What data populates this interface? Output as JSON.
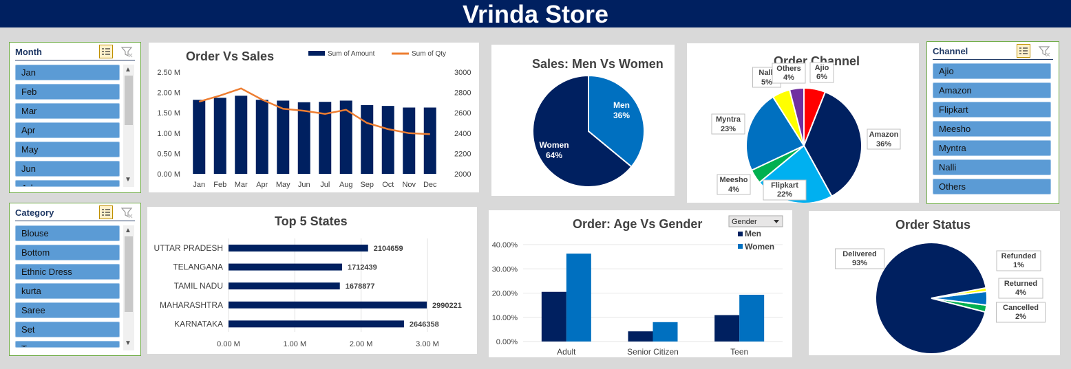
{
  "header": {
    "title": "Vrinda Store"
  },
  "colors": {
    "navy": "#002060",
    "blue": "#0070c0",
    "orange": "#ed7d31",
    "slicer_item": "#5b9bd5"
  },
  "slicers": {
    "month": {
      "title": "Month",
      "items": [
        "Jan",
        "Feb",
        "Mar",
        "Apr",
        "May",
        "Jun",
        "Jul"
      ]
    },
    "category": {
      "title": "Category",
      "items": [
        "Blouse",
        "Bottom",
        "Ethnic Dress",
        "kurta",
        "Saree",
        "Set",
        "Top"
      ]
    },
    "channel": {
      "title": "Channel",
      "items": [
        "Ajio",
        "Amazon",
        "Flipkart",
        "Meesho",
        "Myntra",
        "Nalli",
        "Others"
      ]
    }
  },
  "order_vs_sales": {
    "title": "Order Vs Sales",
    "legend": [
      "Sum of Amount",
      "Sum of Qty"
    ],
    "left_ticks": [
      "2.50 M",
      "2.00 M",
      "1.50 M",
      "1.00 M",
      "0.50 M",
      "0.00 M"
    ],
    "right_ticks": [
      "3000",
      "2800",
      "2600",
      "2400",
      "2200",
      "2000"
    ]
  },
  "sales_men_women": {
    "title": "Sales: Men Vs Women",
    "men": "Men",
    "men_pct": "36%",
    "women": "Women",
    "women_pct": "64%"
  },
  "order_channel": {
    "title": "Order Channel"
  },
  "top_states": {
    "title": "Top 5 States",
    "xticks": [
      "0.00 M",
      "1.00 M",
      "2.00 M",
      "3.00 M"
    ]
  },
  "age_gender": {
    "title": "Order: Age Vs Gender",
    "filter": "Gender",
    "yticks": [
      "40.00%",
      "30.00%",
      "20.00%",
      "10.00%",
      "0.00%"
    ]
  },
  "order_status": {
    "title": "Order Status"
  },
  "chart_data": [
    {
      "type": "bar",
      "title": "Order Vs Sales",
      "categories": [
        "Jan",
        "Feb",
        "Mar",
        "Apr",
        "May",
        "Jun",
        "Jul",
        "Aug",
        "Sep",
        "Oct",
        "Nov",
        "Dec"
      ],
      "series": [
        {
          "name": "Sum of Amount",
          "values": [
            1.82,
            1.87,
            1.92,
            1.82,
            1.8,
            1.76,
            1.77,
            1.8,
            1.69,
            1.67,
            1.63,
            1.63
          ]
        },
        {
          "name": "Sum of Qty",
          "values": [
            2710,
            2770,
            2840,
            2730,
            2640,
            2620,
            2590,
            2630,
            2500,
            2440,
            2400,
            2390
          ]
        }
      ],
      "ylim": [
        0,
        2.5
      ],
      "y2lim": [
        2000,
        3000
      ]
    },
    {
      "type": "pie",
      "title": "Sales: Men Vs Women",
      "labels": [
        "Men",
        "Women"
      ],
      "values": [
        36,
        64
      ]
    },
    {
      "type": "pie",
      "title": "Order Channel",
      "labels": [
        "Ajio",
        "Amazon",
        "Flipkart",
        "Meesho",
        "Myntra",
        "Nalli",
        "Others"
      ],
      "values": [
        6,
        36,
        22,
        4,
        23,
        5,
        4
      ]
    },
    {
      "type": "bar",
      "title": "Top 5 States",
      "categories": [
        "UTTAR PRADESH",
        "TELANGANA",
        "TAMIL NADU",
        "MAHARASHTRA",
        "KARNATAKA"
      ],
      "values": [
        2104659,
        1712439,
        1678877,
        2990221,
        2646358
      ],
      "xlim": [
        0,
        3.0
      ]
    },
    {
      "type": "bar",
      "title": "Order: Age Vs Gender",
      "categories": [
        "Adult",
        "Senior Citizen",
        "Teen"
      ],
      "series": [
        {
          "name": "Men",
          "values": [
            20.5,
            4.2,
            10.9
          ]
        },
        {
          "name": "Women",
          "values": [
            36.3,
            8.0,
            19.3
          ]
        }
      ],
      "ylim": [
        0,
        40
      ]
    },
    {
      "type": "pie",
      "title": "Order Status",
      "labels": [
        "Delivered",
        "Refunded",
        "Returned",
        "Cancelled"
      ],
      "values": [
        93,
        1,
        4,
        2
      ]
    }
  ]
}
